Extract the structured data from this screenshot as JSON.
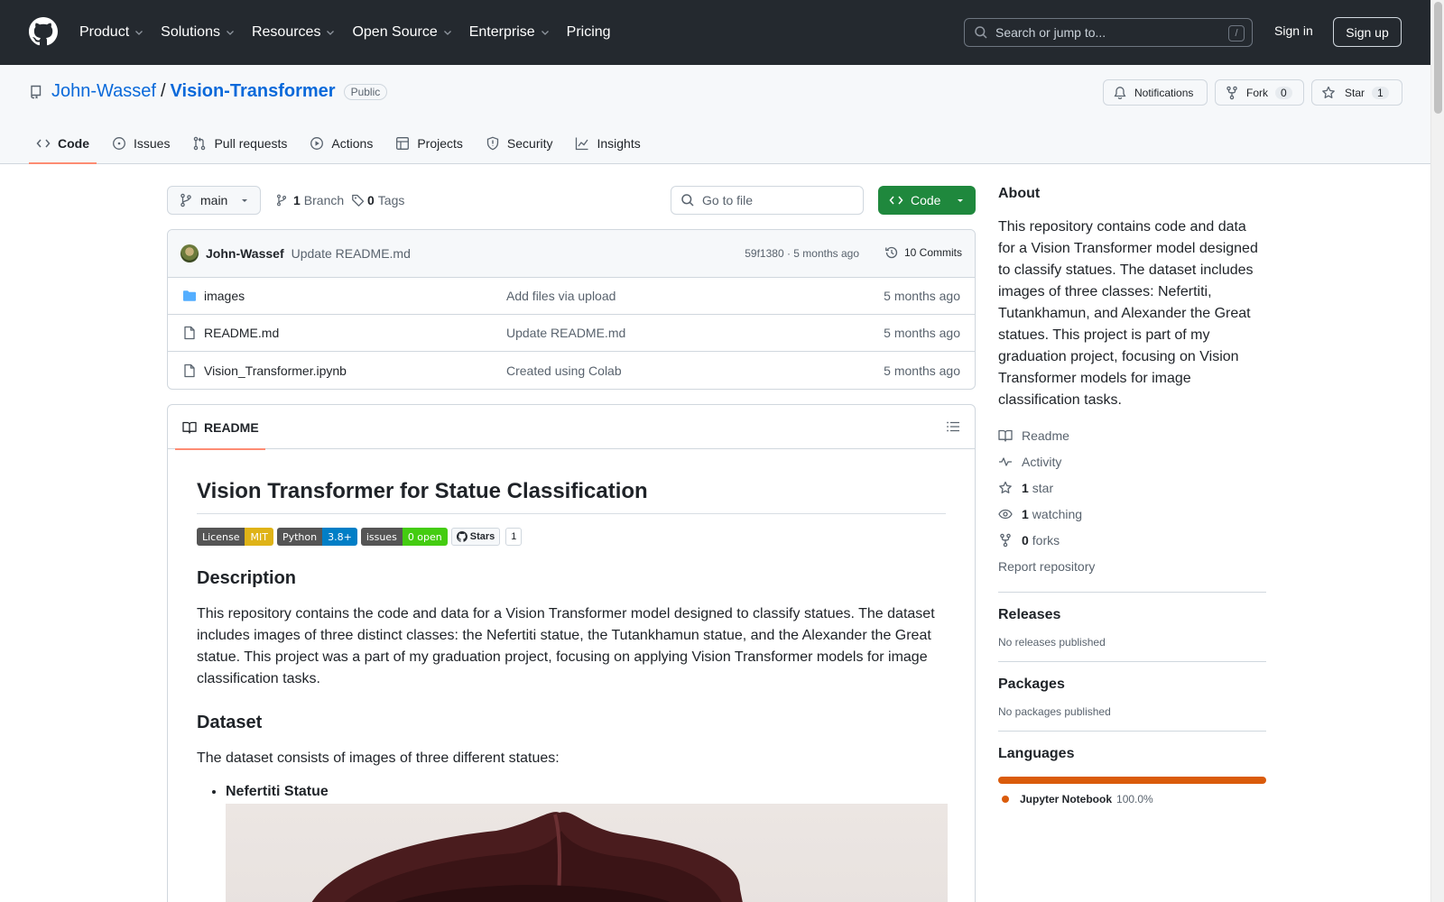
{
  "header": {
    "nav": [
      {
        "label": "Product",
        "dropdown": true
      },
      {
        "label": "Solutions",
        "dropdown": true
      },
      {
        "label": "Resources",
        "dropdown": true
      },
      {
        "label": "Open Source",
        "dropdown": true
      },
      {
        "label": "Enterprise",
        "dropdown": true
      },
      {
        "label": "Pricing",
        "dropdown": false
      }
    ],
    "search_placeholder": "Search or jump to...",
    "search_shortcut": "/",
    "sign_in": "Sign in",
    "sign_up": "Sign up"
  },
  "repo": {
    "owner": "John-Wassef",
    "separator": "/",
    "name": "Vision-Transformer",
    "visibility": "Public",
    "notifications_label": "Notifications",
    "fork_label": "Fork",
    "fork_count": "0",
    "star_label": "Star",
    "star_count": "1",
    "tabs": [
      {
        "label": "Code",
        "icon": "code-icon",
        "active": true
      },
      {
        "label": "Issues",
        "icon": "issue-icon",
        "active": false
      },
      {
        "label": "Pull requests",
        "icon": "pull-request-icon",
        "active": false
      },
      {
        "label": "Actions",
        "icon": "play-icon",
        "active": false
      },
      {
        "label": "Projects",
        "icon": "table-icon",
        "active": false
      },
      {
        "label": "Security",
        "icon": "shield-icon",
        "active": false
      },
      {
        "label": "Insights",
        "icon": "graph-icon",
        "active": false
      }
    ]
  },
  "code_toolbar": {
    "branch": "main",
    "branch_count": "1",
    "branch_label": "Branch",
    "tag_count": "0",
    "tag_label": "Tags",
    "goto_file": "Go to file",
    "code_button": "Code"
  },
  "latest_commit": {
    "author": "John-Wassef",
    "message": "Update README.md",
    "meta": "59f1380 · 5 months ago",
    "commits_label": "10 Commits"
  },
  "files": [
    {
      "name": "images",
      "type": "folder",
      "message": "Add files via upload",
      "date": "5 months ago"
    },
    {
      "name": "README.md",
      "type": "file",
      "message": "Update README.md",
      "date": "5 months ago"
    },
    {
      "name": "Vision_Transformer.ipynb",
      "type": "file",
      "message": "Created using Colab",
      "date": "5 months ago"
    }
  ],
  "readme": {
    "tab_label": "README",
    "title": "Vision Transformer for Statue Classification",
    "badges": [
      {
        "left": "License",
        "right": "MIT",
        "color": "#dfb317"
      },
      {
        "left": "Python",
        "right": "3.8+",
        "color": "#007ec6"
      },
      {
        "left": "issues",
        "right": "0 open",
        "color": "#4c1"
      }
    ],
    "gh_stars_label": "Stars",
    "gh_stars_count": "1",
    "description_heading": "Description",
    "description_text": "This repository contains the code and data for a Vision Transformer model designed to classify statues. The dataset includes images of three distinct classes: the Nefertiti statue, the Tutankhamun statue, and the Alexander the Great statue. This project was a part of my graduation project, focusing on applying Vision Transformer models for image classification tasks.",
    "dataset_heading": "Dataset",
    "dataset_text": "The dataset consists of images of three different statues:",
    "dataset_items": [
      "Nefertiti Statue"
    ]
  },
  "about": {
    "heading": "About",
    "text": "This repository contains code and data for a Vision Transformer model designed to classify statues. The dataset includes images of three classes: Nefertiti, Tutankhamun, and Alexander the Great statues. This project is part of my graduation project, focusing on Vision Transformer models for image classification tasks.",
    "readme_link": "Readme",
    "activity_link": "Activity",
    "stars_count": "1",
    "stars_label": "star",
    "watching_count": "1",
    "watching_label": "watching",
    "forks_count": "0",
    "forks_label": "forks",
    "report_link": "Report repository"
  },
  "releases": {
    "heading": "Releases",
    "text": "No releases published"
  },
  "packages": {
    "heading": "Packages",
    "text": "No packages published"
  },
  "languages": {
    "heading": "Languages",
    "items": [
      {
        "name": "Jupyter Notebook",
        "percent": "100.0%",
        "color": "#DA5B0B"
      }
    ]
  },
  "colors": {
    "header_bg": "#24292f",
    "accent": "#0969da",
    "code_green": "#1f883d",
    "tab_underline": "#fd8c73"
  }
}
